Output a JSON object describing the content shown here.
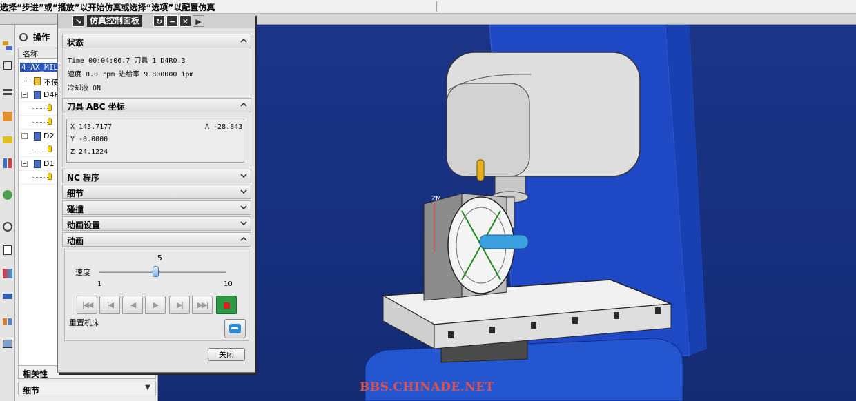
{
  "prompt": {
    "text": "选择“步进”或“播放”以开始仿真或选择“选项”以配置仿真"
  },
  "navigator": {
    "tab_label": "操作",
    "column_header": "名称",
    "tree": [
      {
        "label": "4-AX_MILL",
        "selected": true
      },
      {
        "label": "不使"
      },
      {
        "label": "D4R"
      },
      {
        "label": ""
      },
      {
        "label": ""
      },
      {
        "label": "D2"
      },
      {
        "label": ""
      },
      {
        "label": "D1"
      },
      {
        "label": ""
      }
    ],
    "sections": [
      {
        "label": "相关性"
      },
      {
        "label": "细节"
      }
    ]
  },
  "dialog": {
    "title": "仿真控制面板",
    "title_buttons": [
      "↘",
      "↻",
      "−",
      "✕",
      "▶"
    ],
    "status": {
      "header": "状态",
      "line1": "Time 00:04:06.7 刀具 1   D4R0.3",
      "line2": "速度 0.0 rpm    进给率 9.800000 ipm",
      "line3": "冷却液 ON"
    },
    "coords": {
      "header": "刀具 ABC 坐标",
      "x": "X 143.7177",
      "y": "Y -0.0000",
      "z": "Z 24.1224",
      "a": "A -28.843"
    },
    "collapsed_sections": [
      {
        "label": "NC 程序"
      },
      {
        "label": "细节"
      },
      {
        "label": "碰撞"
      },
      {
        "label": "动画设置"
      }
    ],
    "animation": {
      "header": "动画",
      "speed_label": "速度",
      "speed_value": "5",
      "speed_fraction": 0.444,
      "min_label": "1",
      "max_label": "10",
      "reset_label": "重置机床",
      "buttons": [
        "first-icon",
        "prev-op-icon",
        "step-back-icon",
        "step-forward-icon",
        "next-op-icon",
        "last-icon",
        "stop-icon"
      ]
    },
    "close_label": "关闭"
  },
  "viewport": {
    "watermark": "BBS.CHINADE.NET",
    "axis_label": "ZM",
    "background_color": "#17307e"
  }
}
